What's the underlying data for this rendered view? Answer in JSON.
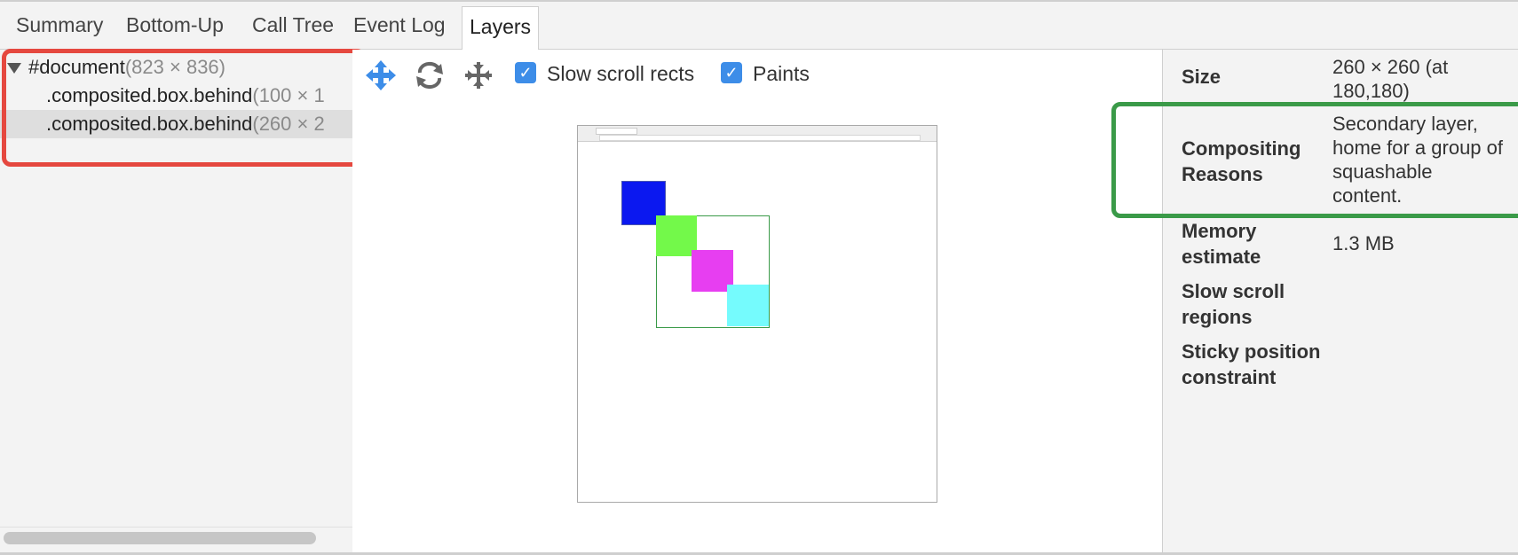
{
  "tabs": [
    {
      "label": "Summary"
    },
    {
      "label": "Bottom-Up"
    },
    {
      "label": "Call Tree"
    },
    {
      "label": "Event Log"
    },
    {
      "label": "Layers",
      "active": true
    }
  ],
  "tree": {
    "rows": [
      {
        "name": "#document",
        "dims": "(823 × 836)"
      },
      {
        "name": ".composited.box.behind",
        "dims": "(100 × 1"
      },
      {
        "name": ".composited.box.behind",
        "dims": "(260 × 2",
        "selected": true
      }
    ]
  },
  "toolbar": {
    "pan_icon": "pan-arrows-icon",
    "rotate_icon": "rotate-icon",
    "reset_icon": "reset-view-icon",
    "slow_scroll_label": "Slow scroll rects",
    "slow_scroll_checked": true,
    "paints_label": "Paints",
    "paints_checked": true
  },
  "colors": {
    "checkbox": "#3d8de8",
    "highlight_red": "#e5483f",
    "highlight_green": "#3a9a48",
    "box_blue": "#0b18f0",
    "box_green": "#73f94a",
    "box_magenta": "#e73ef1",
    "box_cyan": "#75fbfd"
  },
  "details": {
    "rows": [
      {
        "label": "Size",
        "value": "260 × 260 (at 180,180)"
      },
      {
        "label": "Compositing Reasons",
        "value": "Secondary layer, home for a group of squashable content."
      },
      {
        "label": "Memory estimate",
        "value": "1.3 MB"
      },
      {
        "label": "Slow scroll regions",
        "value": ""
      },
      {
        "label": "Sticky position constraint",
        "value": ""
      }
    ]
  }
}
